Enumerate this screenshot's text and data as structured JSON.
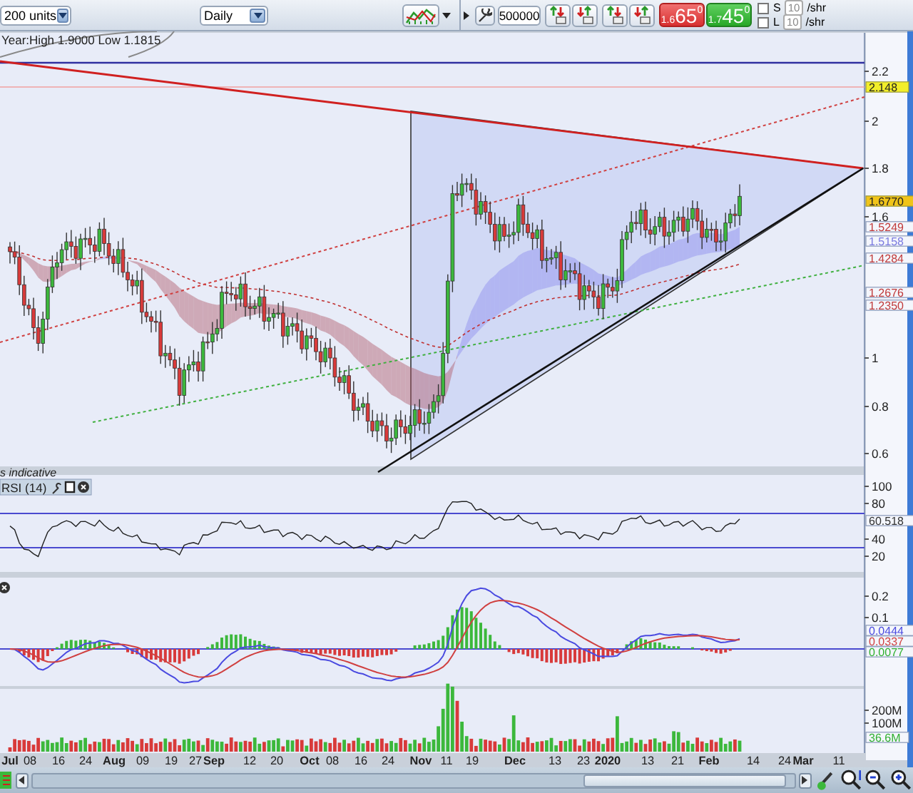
{
  "toolbar": {
    "units": "200 units",
    "interval": "Daily",
    "quantity": "500000",
    "sell": {
      "small": "1.6",
      "big": "65",
      "sup": "0"
    },
    "buy": {
      "small": "1.7",
      "big": "45",
      "sup": "0"
    },
    "short": {
      "label": "S",
      "value": "10",
      "unit": "/shr",
      "checked": false
    },
    "long": {
      "label": "L",
      "value": "10",
      "unit": "/shr",
      "checked": false
    }
  },
  "price_chart": {
    "info": "Year:High 1.9000 Low 1.1815",
    "note": "s indicative",
    "y_labels": [
      "2.2",
      "2",
      "1.8",
      "1.6",
      "1",
      "0.8",
      "0.6"
    ],
    "tags": [
      {
        "text": "2.148",
        "kind": "filled",
        "color": "#f2ee2a"
      },
      {
        "text": "1.6770",
        "kind": "filled",
        "color": "#f0c419"
      },
      {
        "text": "1.5249",
        "kind": "outline",
        "color": "#c03a3a"
      },
      {
        "text": "1.5158",
        "kind": "outline",
        "color": "#7a7ae0"
      },
      {
        "text": "1.4284",
        "kind": "outline",
        "color": "#c03a3a"
      },
      {
        "text": "1.2676",
        "kind": "outline",
        "color": "#c03a3a"
      },
      {
        "text": "1.2350",
        "kind": "outline",
        "color": "#c03a3a"
      }
    ]
  },
  "rsi_panel": {
    "title": "RSI (14)",
    "y_labels": [
      "100",
      "80",
      "40",
      "20"
    ],
    "tags": [
      {
        "text": "60.518",
        "kind": "outline",
        "color": "#333333"
      }
    ]
  },
  "macd_panel": {
    "y_labels": [
      "0.2",
      "0.1"
    ],
    "tags": [
      {
        "text": "0.0444",
        "kind": "outline",
        "color": "#4a4ae0"
      },
      {
        "text": "0.0337",
        "kind": "outline",
        "color": "#d04040"
      },
      {
        "text": "0.0077",
        "kind": "outline",
        "color": "#30b030"
      }
    ]
  },
  "volume_panel": {
    "y_labels": [
      "200M",
      "100M"
    ],
    "tags": [
      {
        "text": "36.6M",
        "kind": "outline",
        "color": "#30b030"
      }
    ]
  },
  "x_labels": [
    {
      "label": "Jul",
      "major": true
    },
    {
      "label": "08",
      "major": false
    },
    {
      "label": "16",
      "major": false
    },
    {
      "label": "24",
      "major": false
    },
    {
      "label": "Aug",
      "major": true
    },
    {
      "label": "09",
      "major": false
    },
    {
      "label": "19",
      "major": false
    },
    {
      "label": "27",
      "major": false
    },
    {
      "label": "Sep",
      "major": true
    },
    {
      "label": "12",
      "major": false
    },
    {
      "label": "20",
      "major": false
    },
    {
      "label": "Oct",
      "major": true
    },
    {
      "label": "08",
      "major": false
    },
    {
      "label": "16",
      "major": false
    },
    {
      "label": "24",
      "major": false
    },
    {
      "label": "Nov",
      "major": true
    },
    {
      "label": "11",
      "major": false
    },
    {
      "label": "19",
      "major": false
    },
    {
      "label": "Dec",
      "major": true
    },
    {
      "label": "13",
      "major": false
    },
    {
      "label": "23",
      "major": false
    },
    {
      "label": "2020",
      "major": true
    },
    {
      "label": "13",
      "major": false
    },
    {
      "label": "21",
      "major": false
    },
    {
      "label": "Feb",
      "major": true
    },
    {
      "label": "14",
      "major": false
    },
    {
      "label": "24",
      "major": false
    },
    {
      "label": "Mar",
      "major": true
    },
    {
      "label": "11",
      "major": false
    }
  ]
}
